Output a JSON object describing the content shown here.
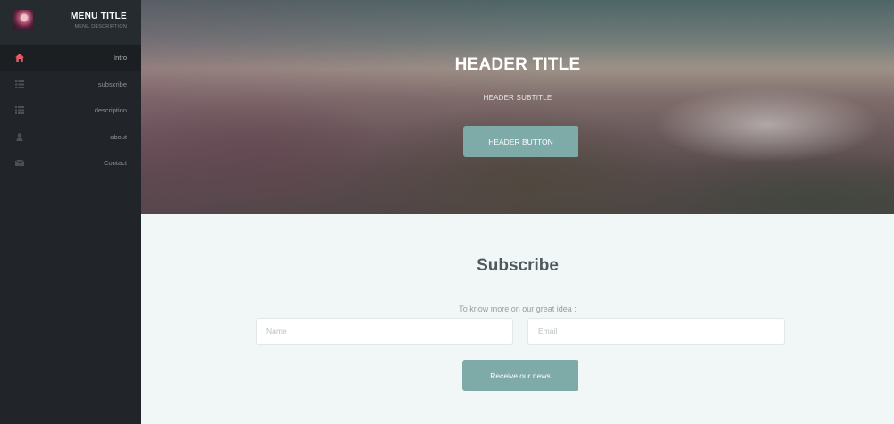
{
  "sidebar": {
    "title": "MENU TITLE",
    "description": "MENU DESCRIPTION",
    "items": [
      {
        "label": "Intro",
        "icon": "home-icon",
        "active": true
      },
      {
        "label": "subscribe",
        "icon": "grid-icon",
        "active": false
      },
      {
        "label": "description",
        "icon": "list-icon",
        "active": false
      },
      {
        "label": "about",
        "icon": "user-icon",
        "active": false
      },
      {
        "label": "Contact",
        "icon": "envelope-icon",
        "active": false
      }
    ]
  },
  "header": {
    "title": "HEADER TITLE",
    "subtitle": "HEADER SUBTITLE",
    "button_label": "HEADER BUTTON"
  },
  "subscribe": {
    "title": "Subscribe",
    "text": "To know more on our great idea :",
    "name_placeholder": "Name",
    "email_placeholder": "Email",
    "button_label": "Receive our news"
  },
  "colors": {
    "accent": "#7eaaa8",
    "home_icon": "#e85b66",
    "sidebar_bg": "#212529"
  }
}
